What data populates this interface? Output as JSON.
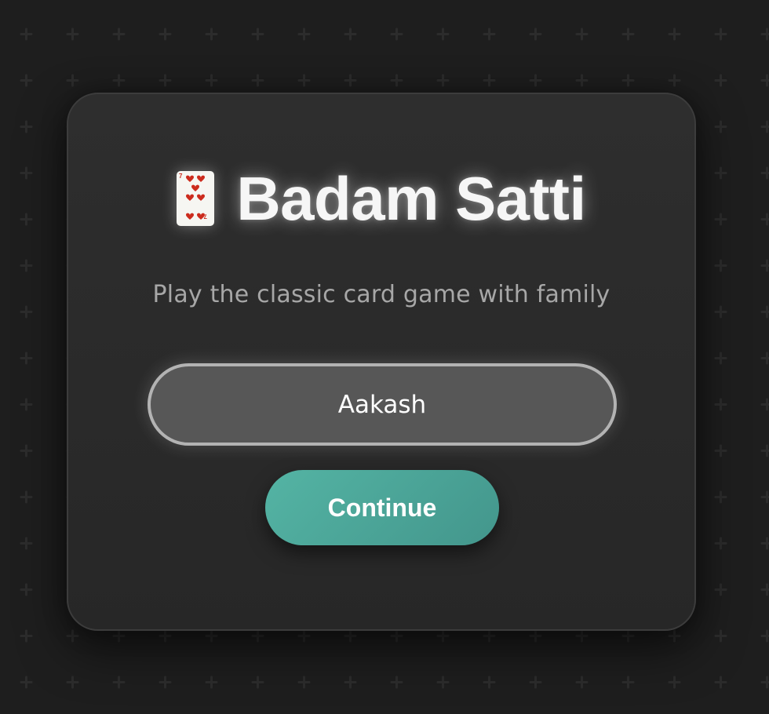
{
  "app": {
    "title": "Badam Satti",
    "title_icon": "seven-of-hearts-card-icon",
    "subtitle": "Play the classic card game with family"
  },
  "name_input": {
    "value": "Aakash"
  },
  "continue_button": {
    "label": "Continue"
  },
  "colors": {
    "background": "#1e1e1e",
    "card_background": "#2b2b2b",
    "accent_teal": "#4fa99b",
    "input_background": "#575757",
    "input_border": "#b3b3b3",
    "heart_red": "#cc2b1d"
  }
}
